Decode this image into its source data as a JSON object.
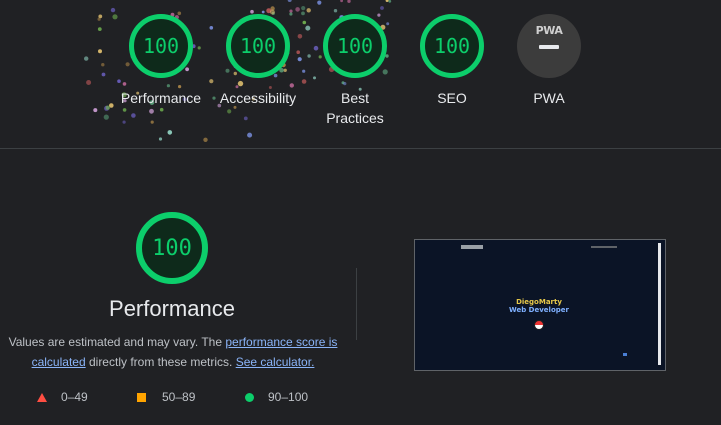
{
  "colors": {
    "background": "#202124",
    "pass": "#0cce6b",
    "average": "#ffa400",
    "fail": "#ff4e42",
    "link": "#8ab4f8"
  },
  "categories": [
    {
      "label": "Performance",
      "score": "100"
    },
    {
      "label": "Accessibility",
      "score": "100"
    },
    {
      "label": "Best Practices",
      "score": "100"
    },
    {
      "label": "SEO",
      "score": "100"
    }
  ],
  "pwa": {
    "badge_text": "PWA",
    "label": "PWA"
  },
  "main": {
    "score": "100",
    "title": "Performance",
    "desc_prefix": "Values are estimated and may vary. The ",
    "link_score": "performance score is calculated",
    "desc_mid": " directly from these metrics. ",
    "link_calc": "See calculator."
  },
  "screenshot": {
    "name": "DiegoMarty",
    "role": "Web Developer"
  },
  "legend": [
    {
      "icon": "triangle-icon",
      "label": "0–49"
    },
    {
      "icon": "square-icon",
      "label": "50–89"
    },
    {
      "icon": "circle-icon",
      "label": "90–100"
    }
  ]
}
